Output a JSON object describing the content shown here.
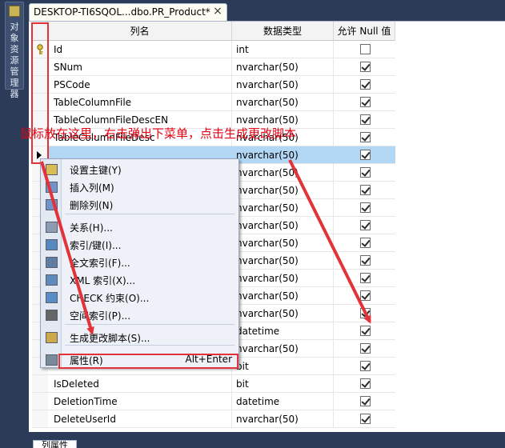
{
  "side_panel": {
    "label": "对象资源管理器"
  },
  "tab": {
    "title": "DESKTOP-TI6SQOL...dbo.PR_Product*",
    "close": "×"
  },
  "columns": {
    "name": "列名",
    "type": "数据类型",
    "nullable": "允许 Null 值"
  },
  "rows": [
    {
      "name": "Id",
      "type": "int",
      "allow_null": false,
      "key": true
    },
    {
      "name": "SNum",
      "type": "nvarchar(50)",
      "allow_null": true
    },
    {
      "name": "PSCode",
      "type": "nvarchar(50)",
      "allow_null": true
    },
    {
      "name": "TableColumnFile",
      "type": "nvarchar(50)",
      "allow_null": true
    },
    {
      "name": "TableColumnFileDescEN",
      "type": "nvarchar(50)",
      "allow_null": true
    },
    {
      "name": "TableColumnFileDesc",
      "type": "nvarchar(50)",
      "allow_null": true
    },
    {
      "name": "",
      "type": "nvarchar(50)",
      "allow_null": true,
      "selected": true
    },
    {
      "name": "",
      "type": "nvarchar(50)",
      "allow_null": true
    },
    {
      "name": "",
      "type": "nvarchar(50)",
      "allow_null": true
    },
    {
      "name": "",
      "type": "nvarchar(50)",
      "allow_null": true
    },
    {
      "name": "",
      "type": "nvarchar(50)",
      "allow_null": true
    },
    {
      "name": "",
      "type": "nvarchar(50)",
      "allow_null": true
    },
    {
      "name": "",
      "type": "nvarchar(50)",
      "allow_null": true
    },
    {
      "name": "",
      "type": "nvarchar(50)",
      "allow_null": true
    },
    {
      "name": "",
      "type": "nvarchar(50)",
      "allow_null": true
    },
    {
      "name": "",
      "type": "nvarchar(50)",
      "allow_null": true
    },
    {
      "name": "",
      "type": "datetime",
      "allow_null": true
    },
    {
      "name": "",
      "type": "nvarchar(50)",
      "allow_null": true
    },
    {
      "name": "",
      "type": "bit",
      "allow_null": true
    },
    {
      "name": "IsDeleted",
      "type": "bit",
      "allow_null": true
    },
    {
      "name": "DeletionTime",
      "type": "datetime",
      "allow_null": true
    },
    {
      "name": "DeleteUserId",
      "type": "nvarchar(50)",
      "allow_null": true
    }
  ],
  "annotation": "鼠标放在这里，右击弹出下菜单，点击生成更改脚本",
  "context_menu": {
    "items": [
      {
        "label": "设置主键(Y)",
        "icon": "key-icon"
      },
      {
        "label": "插入列(M)",
        "icon": "insert-column-icon"
      },
      {
        "label": "删除列(N)",
        "icon": "delete-column-icon"
      },
      {
        "label": "关系(H)...",
        "icon": "relationship-icon"
      },
      {
        "label": "索引/键(I)...",
        "icon": "index-icon"
      },
      {
        "label": "全文索引(F)...",
        "icon": "fulltext-index-icon"
      },
      {
        "label": "XML 索引(X)...",
        "icon": "xml-index-icon"
      },
      {
        "label": "CHECK 约束(O)...",
        "icon": "check-constraint-icon"
      },
      {
        "label": "空间索引(P)...",
        "icon": "spatial-index-icon"
      },
      {
        "label": "生成更改脚本(S)...",
        "icon": "script-icon"
      },
      {
        "label": "属性(R)",
        "icon": "properties-icon",
        "shortcut": "Alt+Enter"
      }
    ]
  },
  "bottom_tab": {
    "label": "列属性"
  },
  "colors": {
    "annotation": "#e60012",
    "highlight_row": "#b2d7f5",
    "frame": "#2b3b58"
  }
}
